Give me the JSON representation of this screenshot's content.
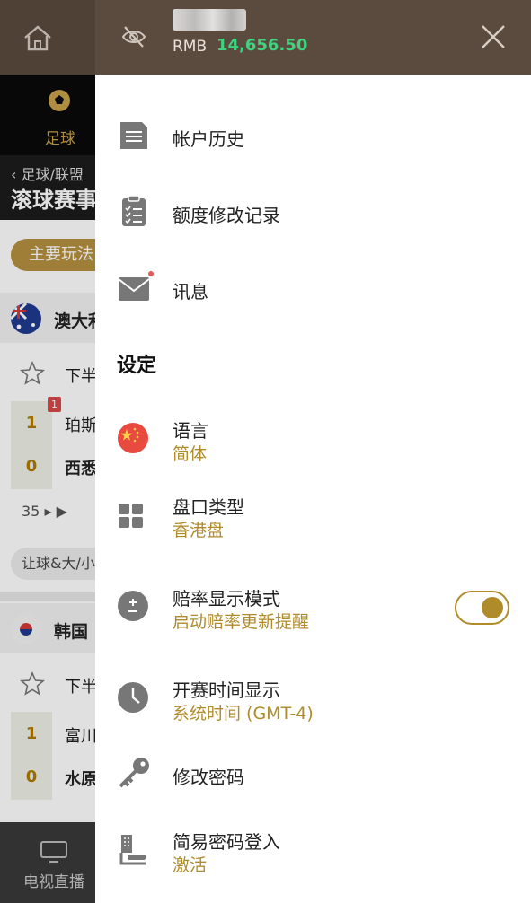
{
  "background_app": {
    "sport_label": "足球",
    "breadcrumb": "足球/联盟",
    "page_title": "滚球赛事",
    "main_tab": "主要玩法",
    "leagues": [
      {
        "name": "澳大利",
        "period": "下半",
        "score_home": "1",
        "score_away": "0",
        "team_home": "珀斯",
        "team_away": "西悉",
        "badge": "1",
        "minute": "35"
      },
      {
        "name": "韩国",
        "period": "下半",
        "score_home": "1",
        "score_away": "0",
        "team_home": "富川",
        "team_away": "水原"
      }
    ],
    "chip": "让球&大/小",
    "bottom_nav_label": "电视直播"
  },
  "drawer": {
    "balance_currency": "RMB",
    "balance_amount": "14,656.50",
    "menu": [
      {
        "icon": "document-icon",
        "label": "帐户历史"
      },
      {
        "icon": "clipboard-checklist-icon",
        "label": "额度修改记录"
      },
      {
        "icon": "mail-icon",
        "label": "讯息"
      }
    ],
    "settings_title": "设定",
    "settings": [
      {
        "icon": "china-flag-icon",
        "label": "语言",
        "value": "简体"
      },
      {
        "icon": "grid-icon",
        "label": "盘口类型",
        "value": "香港盘"
      },
      {
        "icon": "plus-minus-icon",
        "label": "赔率显示模式",
        "value": "启动赔率更新提醒",
        "toggle_on": true
      },
      {
        "icon": "clock-icon",
        "label": "开赛时间显示",
        "value": "系统时间 (GMT-4)"
      },
      {
        "icon": "key-icon",
        "label": "修改密码"
      },
      {
        "icon": "door-lock-icon",
        "label": "简易密码登入",
        "value": "激活"
      }
    ]
  },
  "colors": {
    "header_brown": "#5b4a3e",
    "gold": "#b08b2a",
    "balance_green": "#3fd27f"
  }
}
